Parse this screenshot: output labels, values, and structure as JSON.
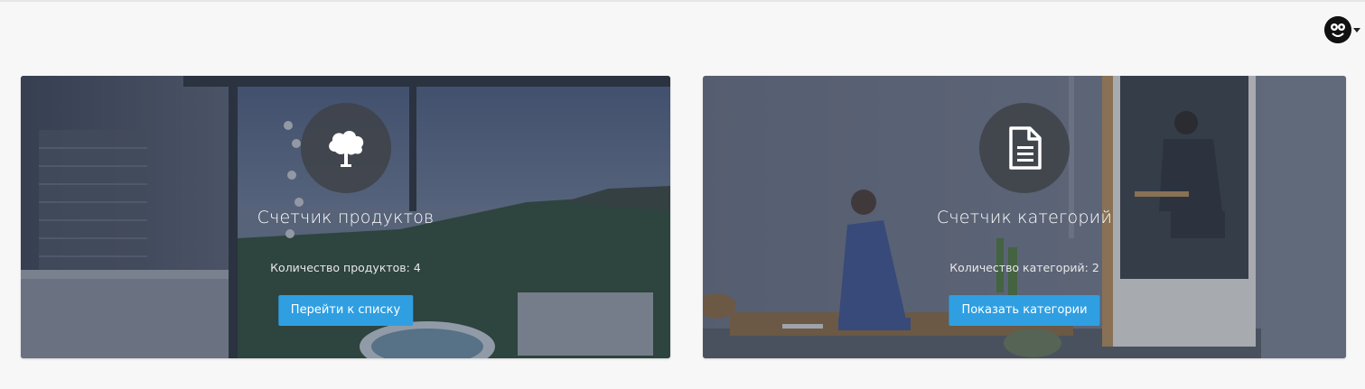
{
  "colors": {
    "accent": "#2f9fe2",
    "page_background": "#f7f7f7",
    "icon_circle": "#3e4248"
  },
  "header": {
    "user_avatar_icon": "user-avatar-icon",
    "dropdown_icon": "caret-down-icon"
  },
  "cards": [
    {
      "icon": "tree-icon",
      "title": "Счетчик продуктов",
      "count_text": "Количество продуктов: 4",
      "button_label": "Перейти к списку"
    },
    {
      "icon": "document-icon",
      "title": "Счетчик категорий",
      "count_text": "Количество категорий: 2",
      "button_label": "Показать категории"
    }
  ]
}
